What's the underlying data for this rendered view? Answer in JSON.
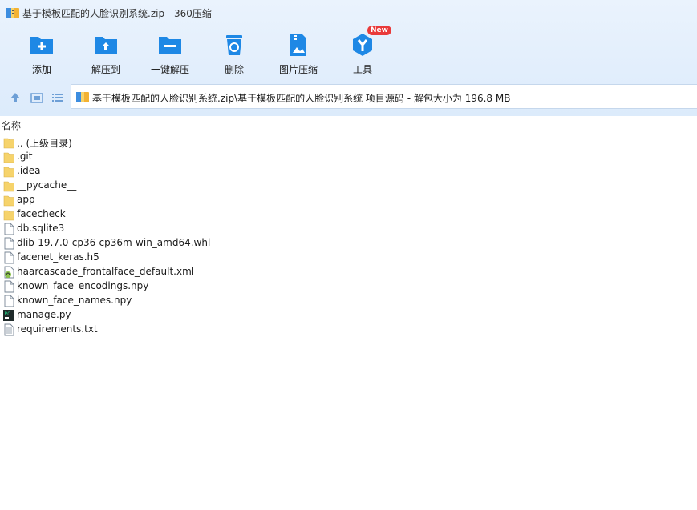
{
  "window": {
    "title": "基于模板匹配的人脸识别系统.zip - 360压缩"
  },
  "toolbar": {
    "items": [
      {
        "label": "添加",
        "icon": "add-archive-icon"
      },
      {
        "label": "解压到",
        "icon": "extract-to-icon"
      },
      {
        "label": "一键解压",
        "icon": "one-click-extract-icon"
      },
      {
        "label": "删除",
        "icon": "delete-icon"
      },
      {
        "label": "图片压缩",
        "icon": "image-compress-icon"
      },
      {
        "label": "工具",
        "icon": "tools-icon",
        "badge": "New"
      }
    ]
  },
  "nav": {
    "path": "基于模板匹配的人脸识别系统.zip\\基于模板匹配的人脸识别系统 项目源码 - 解包大小为 196.8 MB"
  },
  "list": {
    "header_name": "名称",
    "files": [
      {
        "name": ".. (上级目录)",
        "type": "folder"
      },
      {
        "name": ".git",
        "type": "folder"
      },
      {
        "name": ".idea",
        "type": "folder"
      },
      {
        "name": "__pycache__",
        "type": "folder"
      },
      {
        "name": "app",
        "type": "folder"
      },
      {
        "name": "facecheck",
        "type": "folder"
      },
      {
        "name": "db.sqlite3",
        "type": "file"
      },
      {
        "name": "dlib-19.7.0-cp36-cp36m-win_amd64.whl",
        "type": "file"
      },
      {
        "name": "facenet_keras.h5",
        "type": "file"
      },
      {
        "name": "haarcascade_frontalface_default.xml",
        "type": "xml"
      },
      {
        "name": "known_face_encodings.npy",
        "type": "file"
      },
      {
        "name": "known_face_names.npy",
        "type": "file"
      },
      {
        "name": "manage.py",
        "type": "python"
      },
      {
        "name": "requirements.txt",
        "type": "text"
      }
    ]
  },
  "colors": {
    "accent": "#1e88e5",
    "toolbar_bg": "#e2eefc",
    "badge": "#e93a3a",
    "folder": "#f6d36b"
  }
}
